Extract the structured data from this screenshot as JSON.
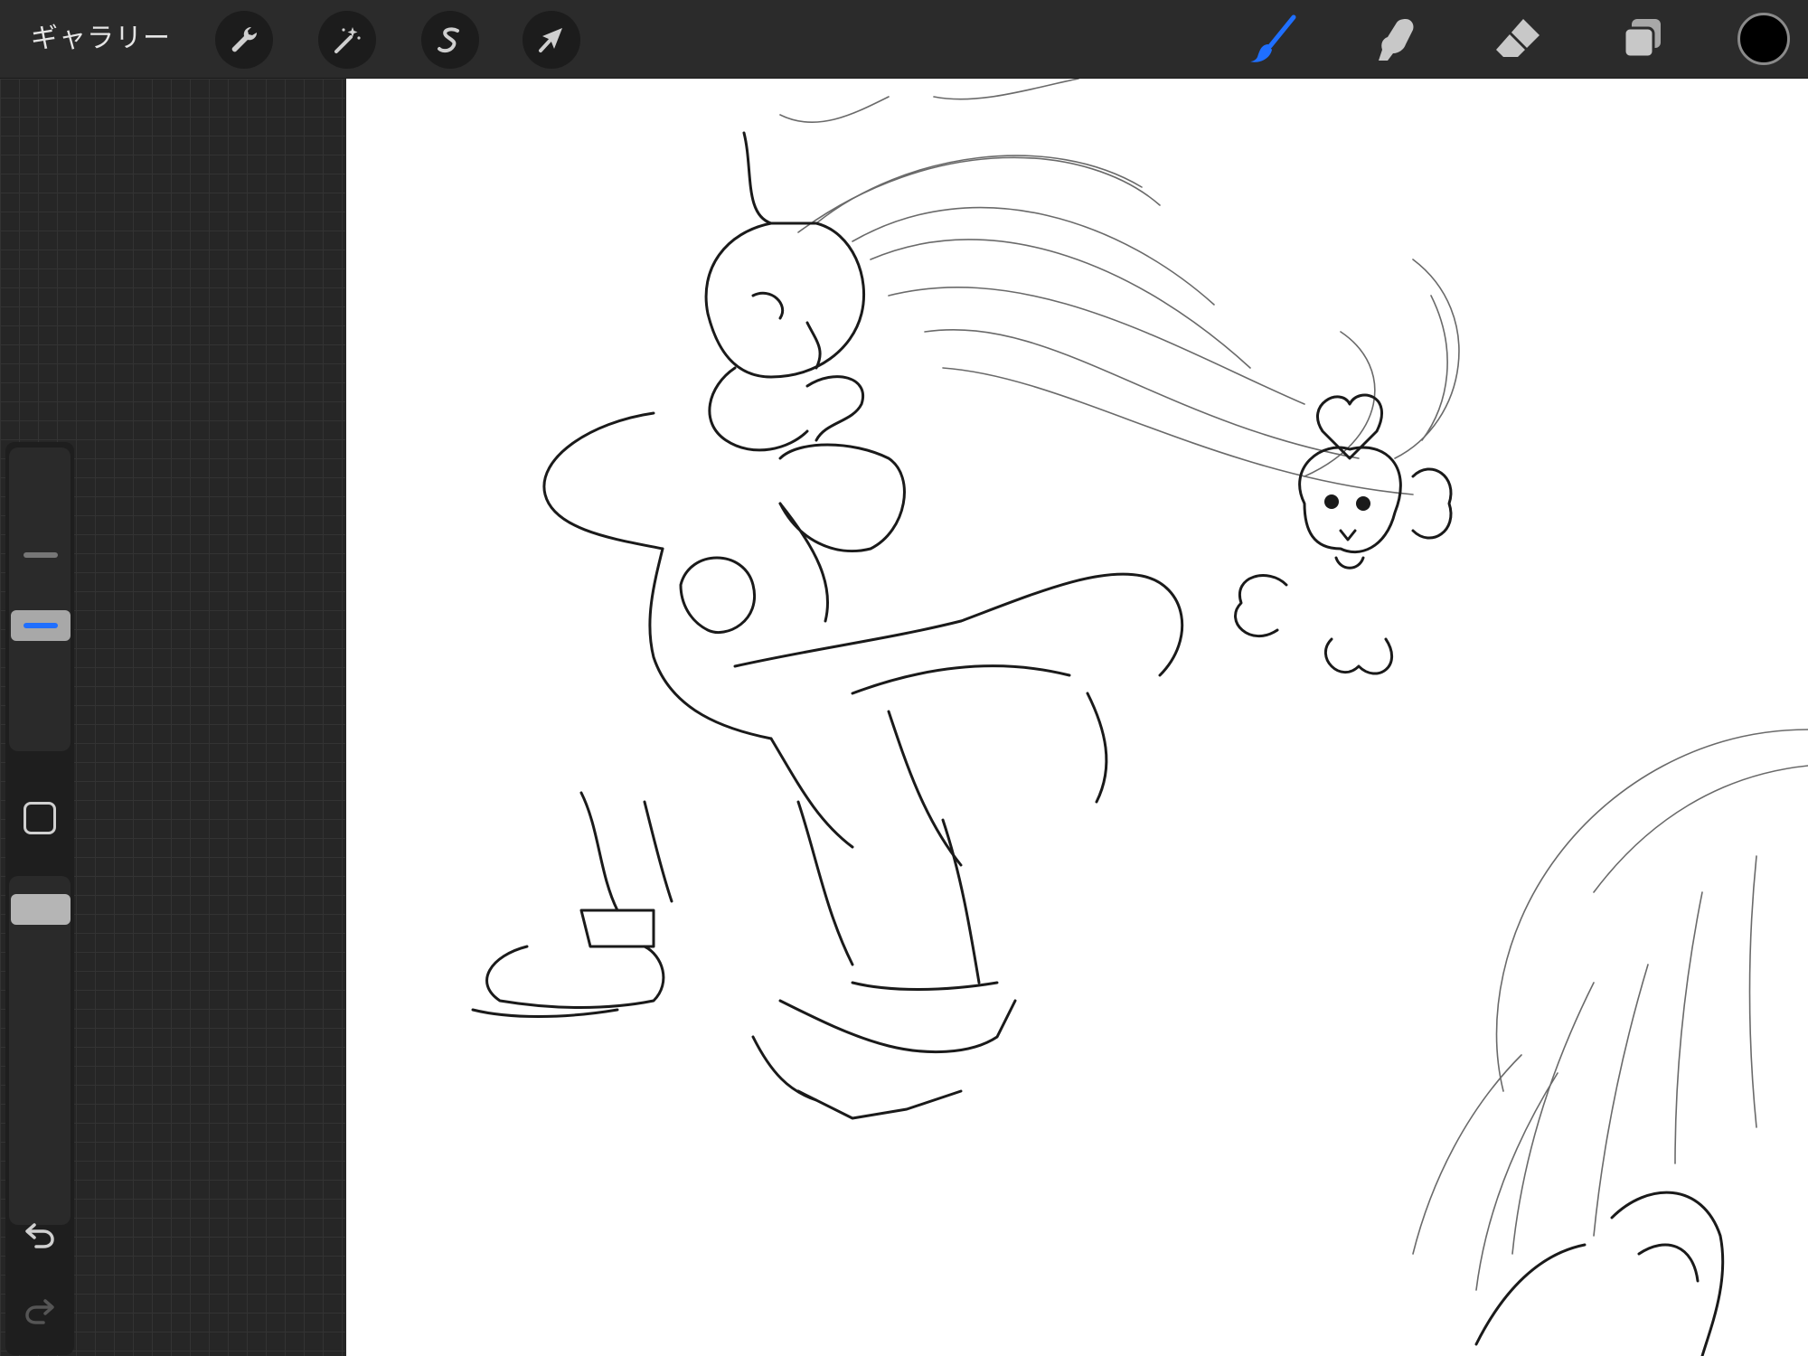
{
  "toolbar": {
    "gallery_label": "ギャラリー",
    "left_tools": [
      {
        "name": "actions",
        "icon": "wrench-icon"
      },
      {
        "name": "adjustments",
        "icon": "magic-wand-icon"
      },
      {
        "name": "selection",
        "icon": "selection-s-icon"
      },
      {
        "name": "transform",
        "icon": "arrow-cursor-icon"
      }
    ],
    "right_tools": [
      {
        "name": "brush",
        "icon": "brush-icon",
        "active": true
      },
      {
        "name": "smudge",
        "icon": "smudge-finger-icon",
        "active": false
      },
      {
        "name": "eraser",
        "icon": "eraser-icon",
        "active": false
      },
      {
        "name": "layers",
        "icon": "layers-icon",
        "active": false
      }
    ],
    "current_color": "#000000",
    "active_color": "#1f6fff"
  },
  "sidebar": {
    "brush_size_slider": {
      "icon": "size-slider"
    },
    "modify_button": {
      "icon": "square-icon"
    },
    "opacity_slider": {
      "icon": "opacity-slider"
    },
    "undo": {
      "icon": "undo-arrow-icon",
      "enabled": true
    },
    "redo": {
      "icon": "redo-arrow-icon",
      "enabled": false
    }
  },
  "canvas": {
    "background": "#ffffff",
    "content": "pencil-sketch"
  }
}
